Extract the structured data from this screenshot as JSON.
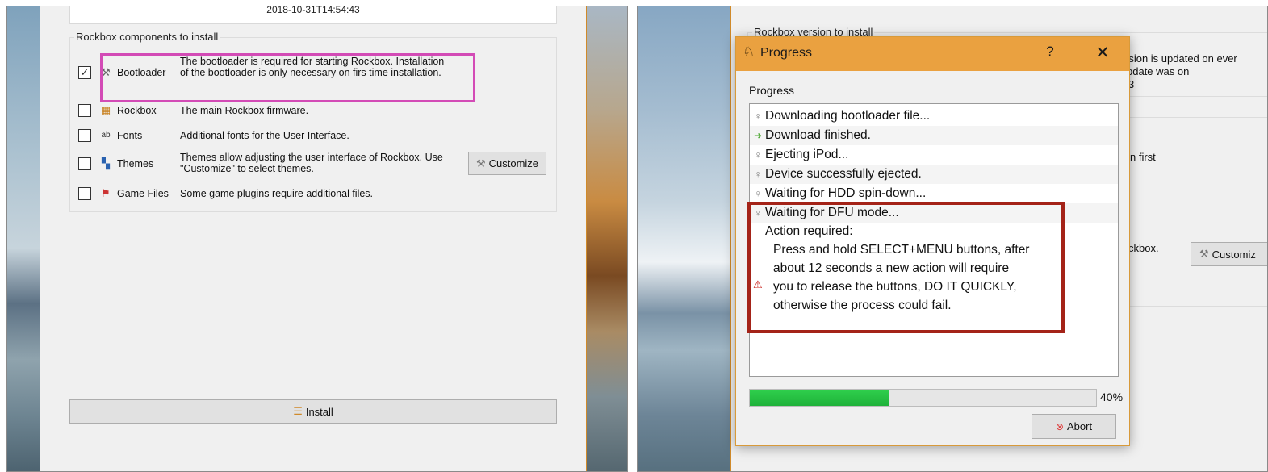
{
  "left_window": {
    "date_value": "2018-10-31T14:54:43",
    "components_group": {
      "title": "Rockbox components to install",
      "items": [
        {
          "name": "Bootloader",
          "checked": true,
          "icon": "tools-icon",
          "description": "The bootloader is required for starting Rockbox. Installation of the bootloader is only necessary on firs time installation."
        },
        {
          "name": "Rockbox",
          "checked": false,
          "icon": "rockbox-icon",
          "description": "The main Rockbox firmware."
        },
        {
          "name": "Fonts",
          "checked": false,
          "icon": "fonts-icon",
          "description": "Additional fonts for the User Interface."
        },
        {
          "name": "Themes",
          "checked": false,
          "icon": "themes-icon",
          "description": "Themes allow adjusting the user interface of Rockbox. Use \"Customize\" to select themes."
        },
        {
          "name": "Game Files",
          "checked": false,
          "icon": "game-files-icon",
          "description": "Some game plugins require additional files."
        }
      ],
      "customize_label": "Customize"
    },
    "install_label": "Install",
    "highlight_color": "#d34bb6"
  },
  "right_window": {
    "bg_group_title": "Rockbox version to install",
    "bg_text_1": "rsion is updated on ever",
    "bg_text_2": "pdate was on",
    "bg_text_3": "3",
    "bg_text_4": "n first",
    "bg_text_5": "ckbox.",
    "bg_customize_label": "Customiz",
    "progress_dialog": {
      "title": "Progress",
      "help_symbol": "?",
      "close_symbol": "✕",
      "label": "Progress",
      "log": [
        {
          "text": "Downloading bootloader file...",
          "icon": "info-icon"
        },
        {
          "text": "Download finished.",
          "icon": "arrow-icon"
        },
        {
          "text": "Ejecting iPod...",
          "icon": "info-icon"
        },
        {
          "text": "Device successfully ejected.",
          "icon": "info-icon"
        },
        {
          "text": "Waiting for HDD spin-down...",
          "icon": "info-icon"
        },
        {
          "text": "Waiting for DFU mode...",
          "icon": "info-icon"
        }
      ],
      "action_title": "Action required:",
      "action_lines": [
        "Press and hold SELECT+MENU buttons, after",
        "about 12 seconds a new action will require",
        "you to release the buttons, DO IT QUICKLY,",
        "otherwise the process could fail."
      ],
      "progress_percent": 40,
      "progress_text": "40%",
      "abort_label": "Abort",
      "highlight_color": "#a42318",
      "progress_color": "#2fcf4c"
    }
  }
}
